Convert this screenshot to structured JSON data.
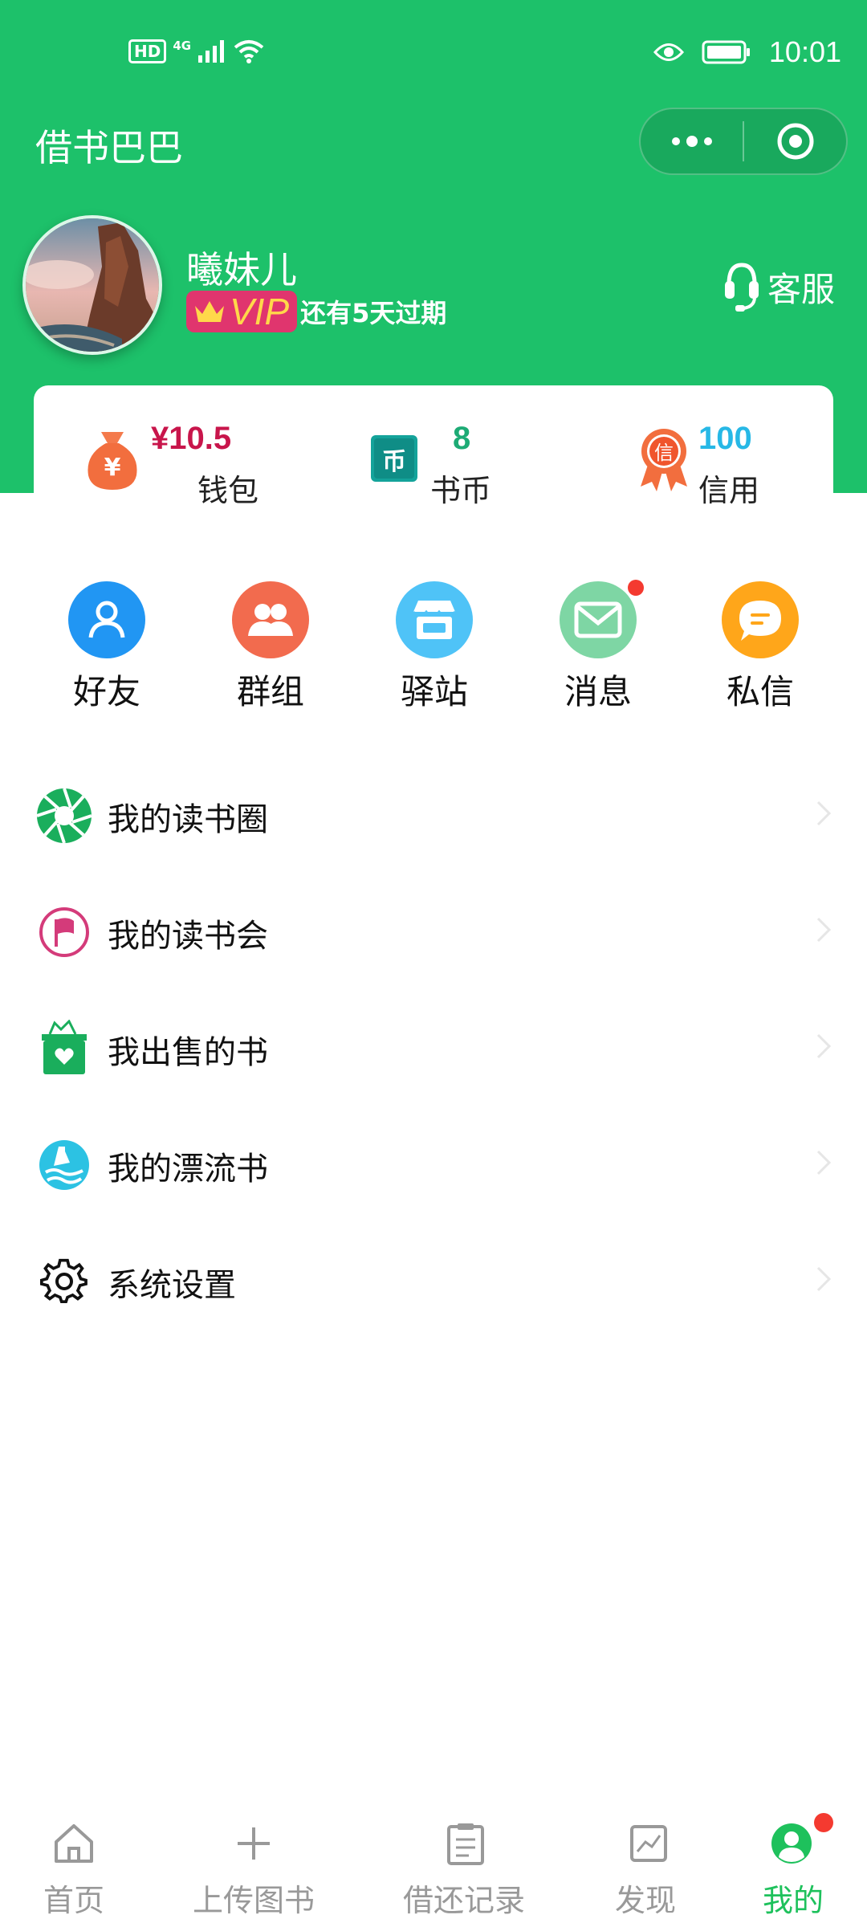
{
  "status_bar": {
    "hd": "HD",
    "network": "4G",
    "time": "10:01"
  },
  "header": {
    "title": "借书巴巴"
  },
  "profile": {
    "name": "曦妹儿",
    "vip_label": "VIP",
    "vip_expire": "还有5天过期",
    "service_label": "客服"
  },
  "stats": [
    {
      "icon": "money-bag-icon",
      "value": "¥10.5",
      "label": "钱包",
      "color": "#c8154b"
    },
    {
      "icon": "coin-book-icon",
      "value": "8",
      "label": "书币",
      "color": "#1dab75"
    },
    {
      "icon": "credit-medal-icon",
      "value": "100",
      "label": "信用",
      "color": "#27b8e6"
    }
  ],
  "quick_actions": [
    {
      "icon": "person-icon",
      "label": "好友",
      "color": "#2196f3"
    },
    {
      "icon": "group-icon",
      "label": "群组",
      "color": "#f26b4e"
    },
    {
      "icon": "store-icon",
      "label": "驿站",
      "color": "#4fc3f7"
    },
    {
      "icon": "mail-icon",
      "label": "消息",
      "color": "#7ed6a4"
    },
    {
      "icon": "chat-bubble-icon",
      "label": "私信",
      "color": "#ffa61a"
    }
  ],
  "menu": [
    {
      "icon": "aperture-icon",
      "label": "我的读书圈"
    },
    {
      "icon": "flag-icon",
      "label": "我的读书会"
    },
    {
      "icon": "gift-box-icon",
      "label": "我出售的书"
    },
    {
      "icon": "drift-bottle-icon",
      "label": "我的漂流书"
    },
    {
      "icon": "gear-icon",
      "label": "系统设置"
    }
  ],
  "bottom_nav": [
    {
      "icon": "home-icon",
      "label": "首页"
    },
    {
      "icon": "plus-icon",
      "label": "上传图书"
    },
    {
      "icon": "clipboard-icon",
      "label": "借还记录"
    },
    {
      "icon": "chart-icon",
      "label": "发现"
    },
    {
      "icon": "user-icon",
      "label": "我的",
      "active": true
    }
  ],
  "colors": {
    "brand_green": "#1dc16a",
    "active_nav": "#1ec15c",
    "vip_pink": "#e0356e",
    "vip_gold": "#ffd84a",
    "notification_red": "#f43a30"
  }
}
